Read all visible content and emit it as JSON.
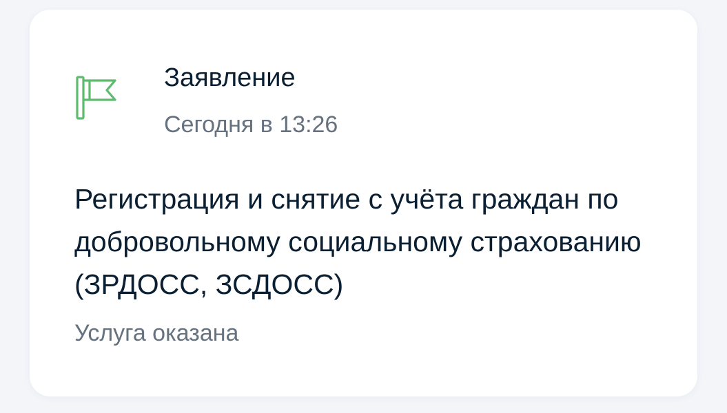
{
  "card": {
    "icon": "flag-icon",
    "icon_color": "#5dbb6e",
    "type_title": "Заявление",
    "date": "Сегодня в 13:26",
    "service_title": "Регистрация и снятие с учёта граждан по добровольному социальному страхованию (ЗРДОСС, ЗСДОСС)",
    "status": "Услуга оказана"
  }
}
